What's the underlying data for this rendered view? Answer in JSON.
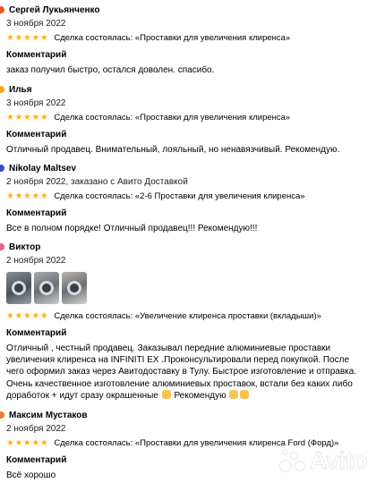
{
  "colors": {
    "star": "#ffb021",
    "avatar_1": "#e85a2c",
    "avatar_2": "#f0a91e",
    "avatar_3": "#3d4cc6",
    "avatar_4": "#ef5b9a",
    "avatar_5": "#f47a2a"
  },
  "reviews": [
    {
      "author": "Сергей Лукьянченко",
      "date": "3 ноября 2022",
      "stars": "★★★★★",
      "deal": "Сделка состоялась: «Проставки для увеличения клиренса»",
      "comment_label": "Комментарий",
      "comment": "заказ получил быстро, остался доволен. спасибо."
    },
    {
      "author": "Илья",
      "date": "3 ноября 2022",
      "stars": "★★★★★",
      "deal": "Сделка состоялась: «Проставки для увеличения клиренса»",
      "comment_label": "Комментарий",
      "comment": "Отличный продавец. Внимательный, лояльный, но ненавязчивый. Рекомендую."
    },
    {
      "author": "Nikolay Maltsev",
      "date": "2 ноября 2022, заказано с Авито Доставкой",
      "stars": "★★★★★",
      "deal": "Сделка состоялась: «2-6 Проставки для увеличения клиренса»",
      "comment_label": "Комментарий",
      "comment": "Все в полном порядке! Отличный продавец!!! Рекомендую!!!"
    },
    {
      "author": "Виктор",
      "date": "2 ноября 2022",
      "stars": "★★★★★",
      "deal": "Сделка состоялась: «Увеличение клиренса проставки (вкладыши)»",
      "comment_label": "Комментарий",
      "comment": "Отличный , честный продавец. Заказывал передние алюминиевые проставки увеличения клиренса на INFINITI EX .Проконсультировали перед покупкой. После чего оформил заказ через Авитодоставку в Тулу. Быстрое изготовление и отправка. Очень качественное изготовление алюминиевых проставок, встали без каких либо доработок + идут сразу окрашенные",
      "comment_end": "Рекомендую"
    },
    {
      "author": "Максим Мустаков",
      "date": "2 ноября 2022",
      "stars": "★★★★★",
      "deal": "Сделка состоялась: «Проставки для увеличения клиренса Ford (Форд)»",
      "comment_label": "Комментарий",
      "comment": "Всё хорошо"
    }
  ],
  "watermark": "Avito"
}
